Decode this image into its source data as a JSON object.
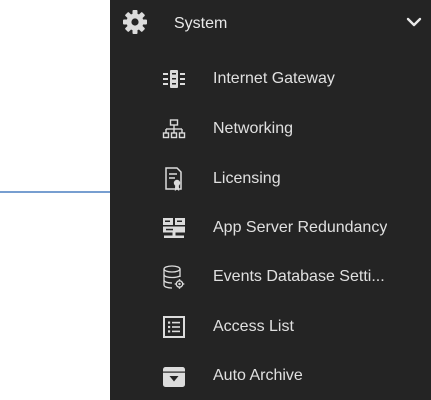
{
  "section": {
    "label": "System",
    "icon": "gear-icon",
    "expanded": true
  },
  "menu": {
    "items": [
      {
        "label": "Internet Gateway",
        "icon": "gateway-icon"
      },
      {
        "label": "Networking",
        "icon": "network-tree-icon"
      },
      {
        "label": "Licensing",
        "icon": "license-document-icon"
      },
      {
        "label": "App Server Redundancy",
        "icon": "server-redundancy-icon"
      },
      {
        "label": "Events Database Setti...",
        "icon": "database-settings-icon"
      },
      {
        "label": "Access List",
        "icon": "list-icon"
      },
      {
        "label": "Auto Archive",
        "icon": "archive-box-icon"
      }
    ]
  },
  "colors": {
    "panel_bg": "#242424",
    "text": "#e0e0e0",
    "icon": "#dcdcdc",
    "annotation_arrow": "#4a7fc1"
  }
}
